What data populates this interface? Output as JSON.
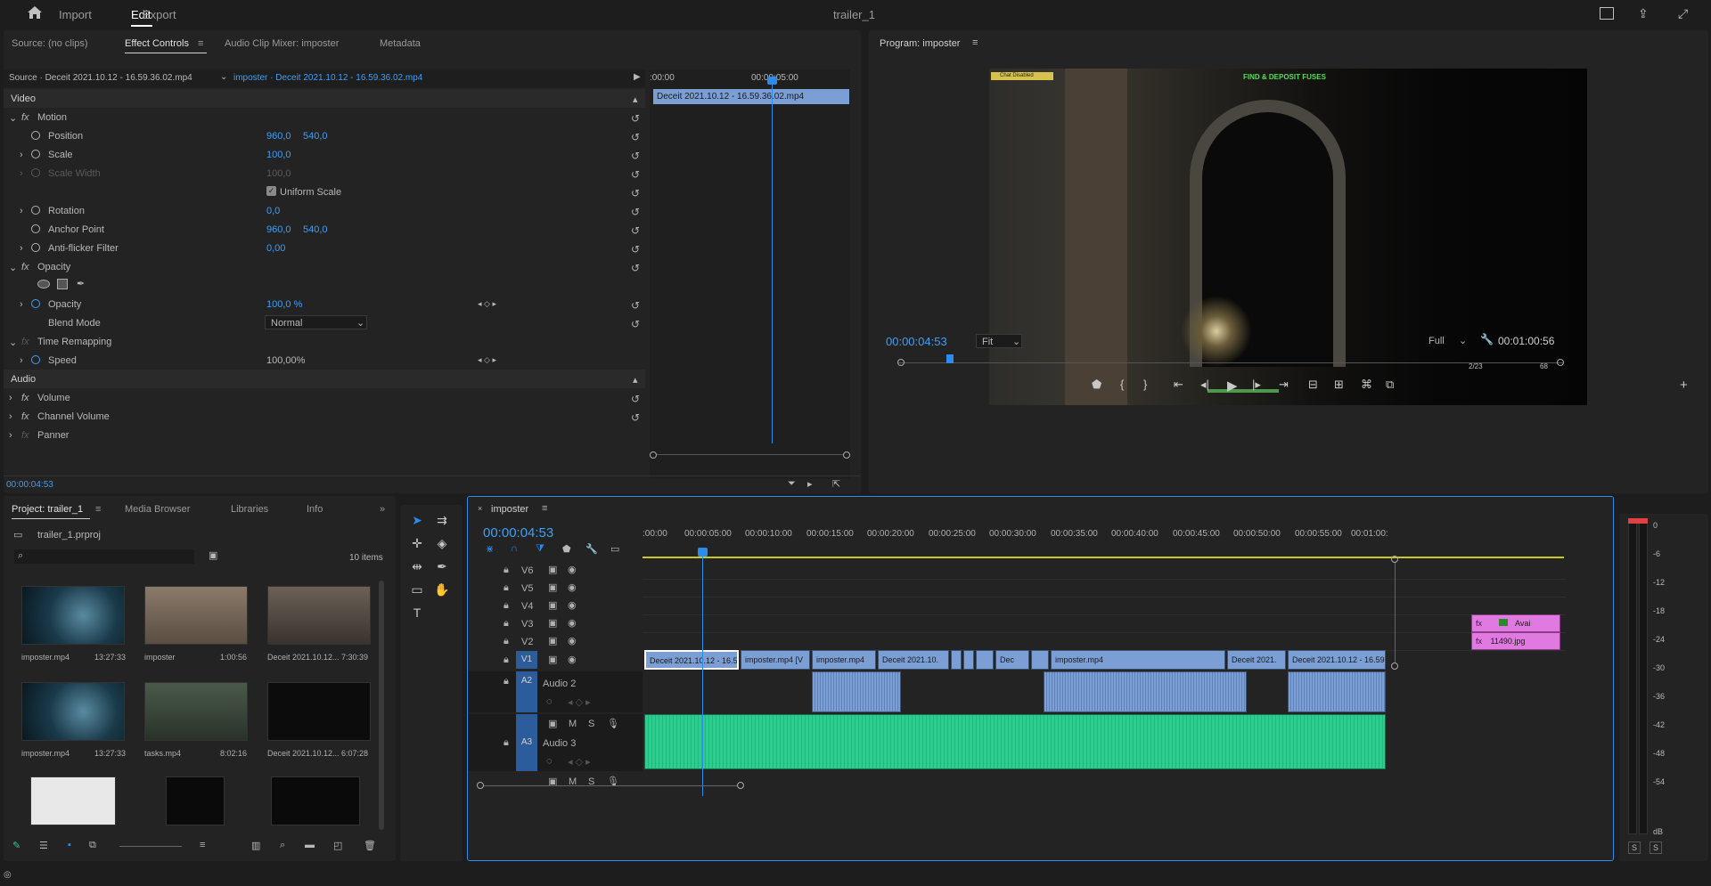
{
  "topbar": {
    "home_label": "⌂",
    "tabs": [
      "Import",
      "Edit",
      "Export"
    ],
    "title": "trailer_1"
  },
  "source_panel": {
    "tabs": [
      "Source: (no clips)",
      "Effect Controls",
      "Audio Clip Mixer: imposter",
      "Metadata"
    ],
    "source_label": "Source · Deceit 2021.10.12 - 16.59.36.02.mp4",
    "sequence_label": "imposter · Deceit 2021.10.12 - 16.59.36.02.mp4",
    "mini_clip": "Deceit 2021.10.12 - 16.59.36.02.mp4",
    "mini_time_start": ":00:00",
    "mini_time_mid": "00:00:05:00",
    "section_video": "Video",
    "section_audio": "Audio",
    "motion": "Motion",
    "position_label": "Position",
    "position_x": "960,0",
    "position_y": "540,0",
    "scale_label": "Scale",
    "scale_val": "100,0",
    "scale_width_label": "Scale Width",
    "scale_width_val": "100,0",
    "uniform_scale": "Uniform Scale",
    "rotation_label": "Rotation",
    "rotation_val": "0,0",
    "anchor_label": "Anchor Point",
    "anchor_x": "960,0",
    "anchor_y": "540,0",
    "antiflicker_label": "Anti-flicker Filter",
    "antiflicker_val": "0,00",
    "opacity_group": "Opacity",
    "opacity_label": "Opacity",
    "opacity_val": "100,0 %",
    "blend_label": "Blend Mode",
    "blend_val": "Normal",
    "time_remap": "Time Remapping",
    "speed_label": "Speed",
    "speed_val": "100,00%",
    "volume": "Volume",
    "channel_volume": "Channel Volume",
    "panner": "Panner",
    "timecode": "00:00:04:53"
  },
  "program": {
    "title": "Program: imposter",
    "timecode": "00:00:04:53",
    "fit": "Fit",
    "quality": "Full",
    "duration": "00:01:00:56",
    "hud_text": "FIND & DEPOSIT FUSES",
    "hud_badge": "Chat Disabled",
    "hud_ammo": "2/23",
    "hud_count": "68"
  },
  "project": {
    "tabs": [
      "Project: trailer_1",
      "Media Browser",
      "Libraries",
      "Info"
    ],
    "file": "trailer_1.prproj",
    "items_count": "10 items",
    "items": [
      {
        "name": "imposter.mp4",
        "dur": "13:27:33"
      },
      {
        "name": "imposter",
        "dur": "1:00:56"
      },
      {
        "name": "Deceit 2021.10.12...",
        "dur": "7:30:39"
      },
      {
        "name": "imposter.mp4",
        "dur": "13:27:33"
      },
      {
        "name": "tasks.mp4",
        "dur": "8:02:16"
      },
      {
        "name": "Deceit 2021.10.12...",
        "dur": "6:07:28"
      }
    ]
  },
  "timeline": {
    "tab": "imposter",
    "timecode": "00:00:04:53",
    "ruler": [
      ":00:00",
      "00:00:05:00",
      "00:00:10:00",
      "00:00:15:00",
      "00:00:20:00",
      "00:00:25:00",
      "00:00:30:00",
      "00:00:35:00",
      "00:00:40:00",
      "00:00:45:00",
      "00:00:50:00",
      "00:00:55:00",
      "00:01:00:"
    ],
    "tracks_video": [
      "V6",
      "V5",
      "V4",
      "V3",
      "V2",
      "V1"
    ],
    "tracks_audio": [
      "A2",
      "A3"
    ],
    "audio2": "Audio 2",
    "audio3": "Audio 3",
    "clips_v1": [
      "Deceit 2021.10.12 - 16.5",
      "imposter.mp4 [V",
      "imposter.mp4",
      "Deceit 2021.10.",
      "Dec",
      "imposter.mp4",
      "Deceit 2021.",
      "Deceit 2021.10.12 - 16.59."
    ],
    "clip_v2": "11490.jpg",
    "clip_v3": "Avai",
    "m_label": "M",
    "s_label": "S"
  },
  "meter": {
    "scale": [
      "0",
      "-6",
      "-12",
      "-18",
      "-24",
      "-30",
      "-36",
      "-42",
      "-48",
      "-54",
      "dB"
    ],
    "solo_left": "S",
    "solo_right": "S"
  },
  "colors": {
    "accent": "#2d8ceb",
    "clip_blue": "#7b9fd4",
    "clip_pink": "#e07ae0",
    "audio_green": "#2ecc8e"
  }
}
